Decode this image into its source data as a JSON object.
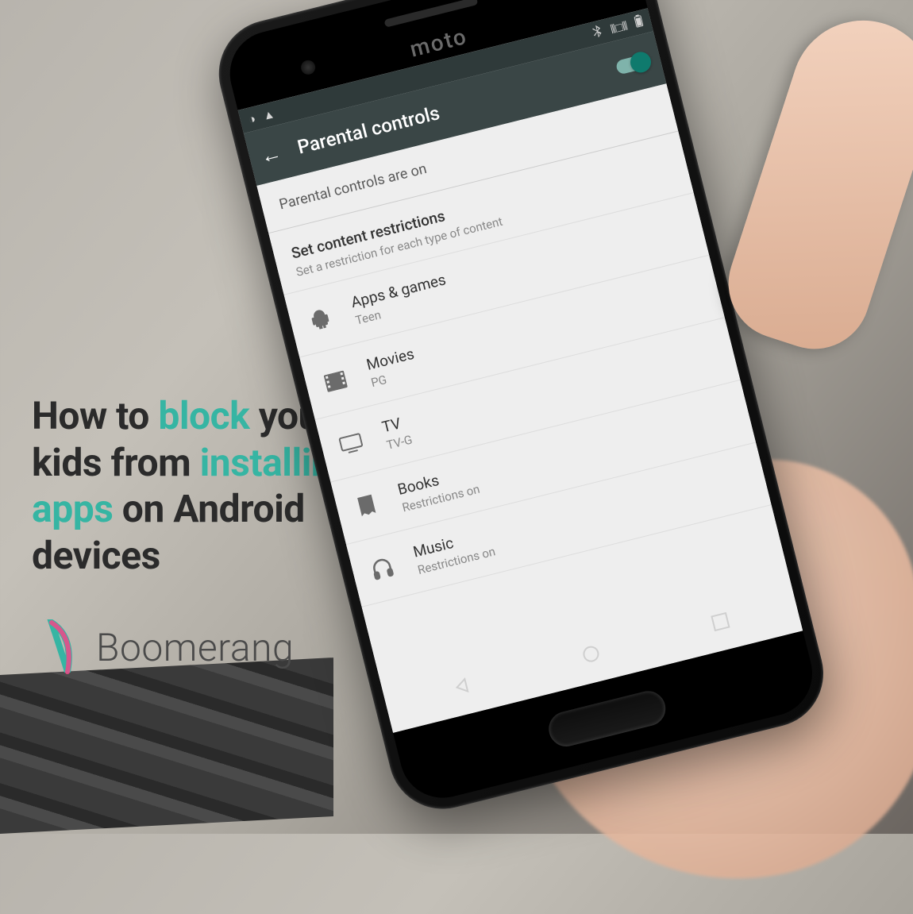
{
  "headline": {
    "part1": "How to ",
    "accent1": "block",
    "part2": " your kids from ",
    "accent2": "installing apps",
    "part3": " on Android devices"
  },
  "brand": {
    "name": "Boomerang"
  },
  "phone": {
    "maker": "moto",
    "status_bar": {
      "left_icons": [
        "debug-icon",
        "warning-icon"
      ],
      "right_icons": [
        "bluetooth-icon",
        "vibrate-icon",
        "battery-icon"
      ]
    },
    "app_bar": {
      "title": "Parental controls",
      "back": "←",
      "toggle_on": true
    },
    "status_line": "Parental controls are on",
    "section": {
      "title": "Set content restrictions",
      "subtitle": "Set a restriction for each type of content"
    },
    "items": [
      {
        "icon": "android-icon",
        "title": "Apps & games",
        "sub": "Teen"
      },
      {
        "icon": "movie-icon",
        "title": "Movies",
        "sub": "PG"
      },
      {
        "icon": "tv-icon",
        "title": "TV",
        "sub": "TV-G"
      },
      {
        "icon": "book-icon",
        "title": "Books",
        "sub": "Restrictions on"
      },
      {
        "icon": "music-icon",
        "title": "Music",
        "sub": "Restrictions on"
      }
    ],
    "nav_keys": [
      "back-key",
      "home-key",
      "recents-key"
    ]
  },
  "colors": {
    "accent": "#36b5a3",
    "toggle": "#0f7a6d",
    "appbar": "#3a4646"
  }
}
